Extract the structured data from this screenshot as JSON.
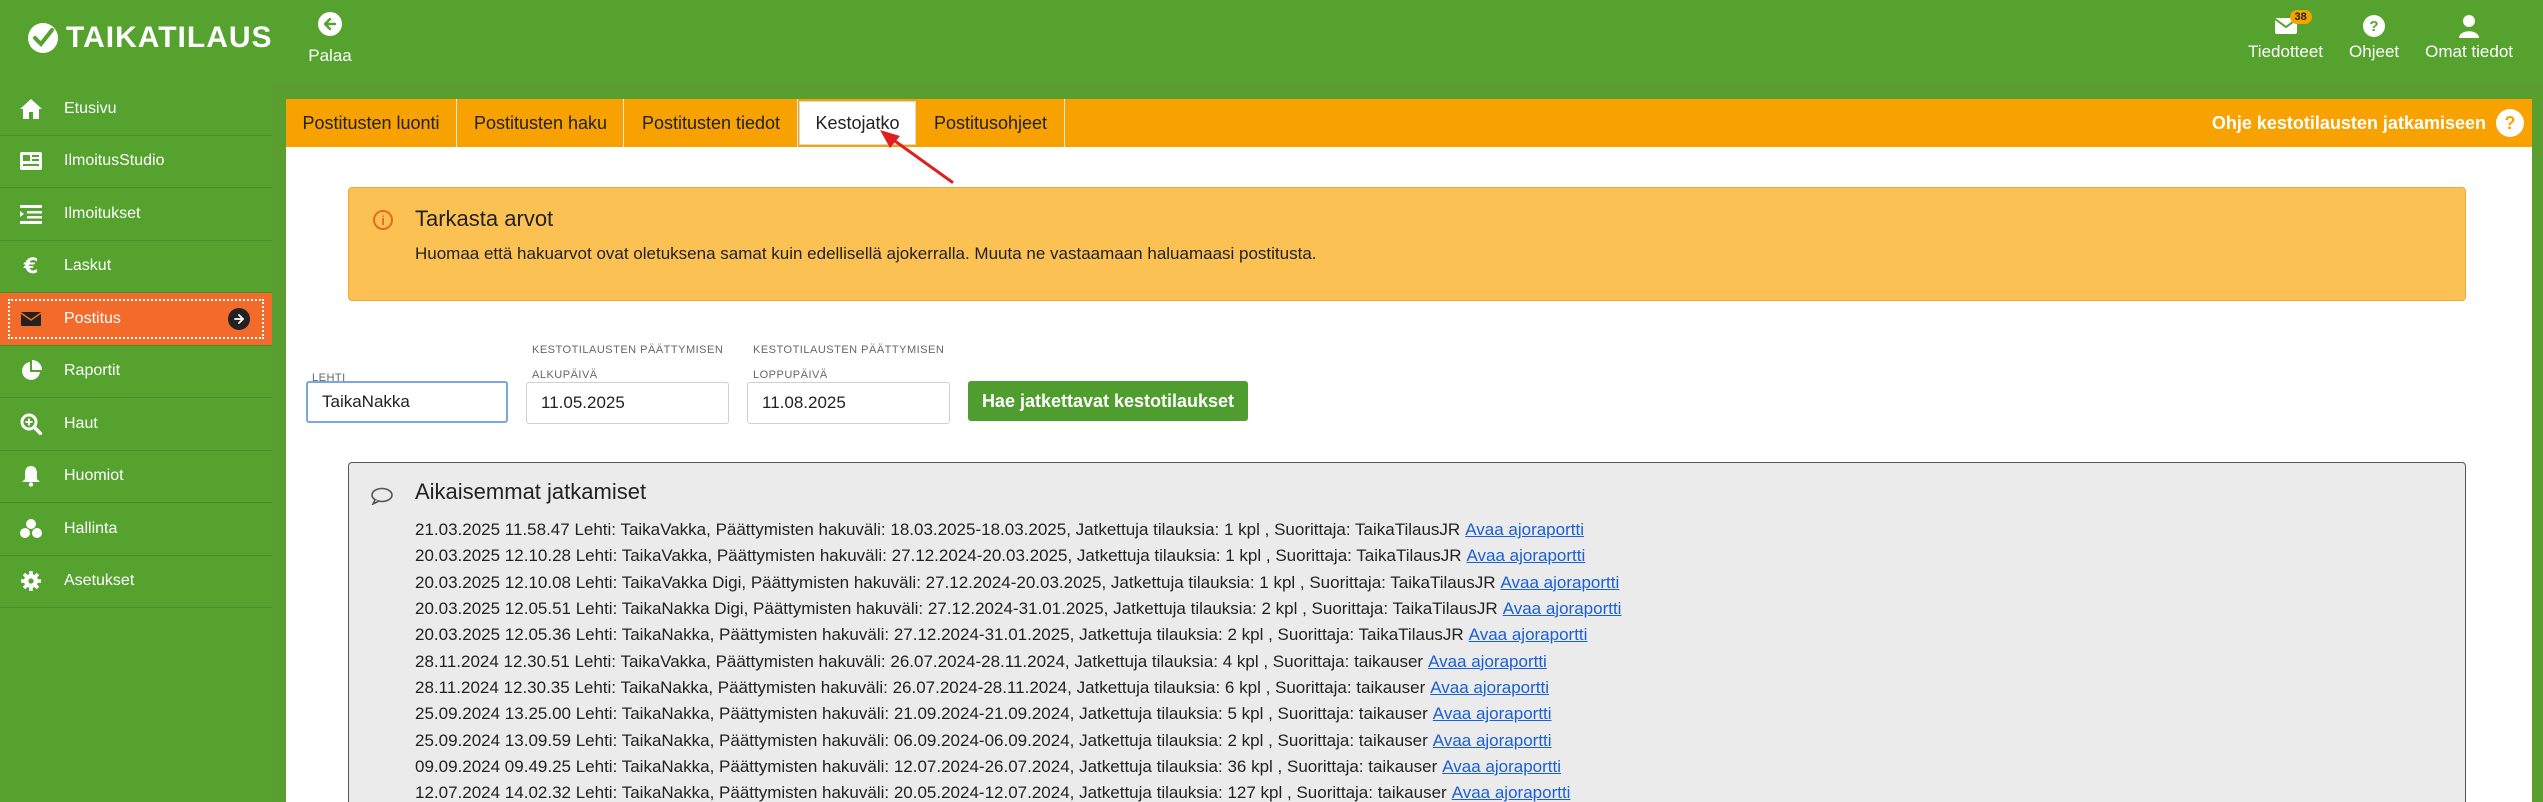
{
  "header": {
    "logo_text": "TAIKATILAUS",
    "back_label": "Palaa",
    "right_items": [
      {
        "label": "Tiedotteet",
        "icon": "mail-icon",
        "badge": "38"
      },
      {
        "label": "Ohjeet",
        "icon": "help-icon"
      },
      {
        "label": "Omat tiedot",
        "icon": "user-icon"
      }
    ]
  },
  "sidebar": {
    "items": [
      {
        "label": "Etusivu",
        "icon": "home-icon"
      },
      {
        "label": "IlmoitusStudio",
        "icon": "newspaper-icon"
      },
      {
        "label": "Ilmoitukset",
        "icon": "list-icon"
      },
      {
        "label": "Laskut",
        "icon": "euro-icon"
      },
      {
        "label": "Postitus",
        "icon": "envelope-icon",
        "active": true
      },
      {
        "label": "Raportit",
        "icon": "pie-chart-icon"
      },
      {
        "label": "Haut",
        "icon": "search-plus-icon"
      },
      {
        "label": "Huomiot",
        "icon": "bell-icon"
      },
      {
        "label": "Hallinta",
        "icon": "cubes-icon"
      },
      {
        "label": "Asetukset",
        "icon": "gear-icon"
      }
    ]
  },
  "tabs": {
    "items": [
      {
        "label": "Postitusten luonti"
      },
      {
        "label": "Postitusten haku"
      },
      {
        "label": "Postitusten tiedot"
      },
      {
        "label": "Kestojatko",
        "active": true
      },
      {
        "label": "Postitusohjeet"
      }
    ],
    "help_label": "Ohje kestotilausten jatkamiseen",
    "help_icon": "?"
  },
  "alert": {
    "icon": "i",
    "title": "Tarkasta arvot",
    "body": "Huomaa että hakuarvot ovat oletuksena samat kuin edellisellä ajokerralla. Muuta ne vastaamaan haluamaasi postitusta."
  },
  "form": {
    "lehti_label": "LEHTI",
    "lehti_value": "TaikaNakka",
    "start_group_label": "KESTOTILAUSTEN PÄÄTTYMISEN",
    "start_label": "ALKUPÄIVÄ",
    "start_value": "11.05.2025",
    "end_group_label": "KESTOTILAUSTEN PÄÄTTYMISEN",
    "end_label": "LOPPUPÄIVÄ",
    "end_value": "11.08.2025",
    "search_button": "Hae jatkettavat kestotilaukset"
  },
  "history": {
    "title": "Aikaisemmat jatkamiset",
    "link_label": "Avaa ajoraportti",
    "rows": [
      {
        "text": "21.03.2025 11.58.47 Lehti: TaikaVakka, Päättymisten hakuväli: 18.03.2025-18.03.2025, Jatkettuja tilauksia: 1 kpl , Suorittaja: TaikaTilausJR"
      },
      {
        "text": "20.03.2025 12.10.28 Lehti: TaikaVakka, Päättymisten hakuväli: 27.12.2024-20.03.2025, Jatkettuja tilauksia: 1 kpl , Suorittaja: TaikaTilausJR"
      },
      {
        "text": "20.03.2025 12.10.08 Lehti: TaikaVakka Digi, Päättymisten hakuväli: 27.12.2024-20.03.2025, Jatkettuja tilauksia: 1 kpl , Suorittaja: TaikaTilausJR"
      },
      {
        "text": "20.03.2025 12.05.51 Lehti: TaikaNakka Digi, Päättymisten hakuväli: 27.12.2024-31.01.2025, Jatkettuja tilauksia: 2 kpl , Suorittaja: TaikaTilausJR"
      },
      {
        "text": "20.03.2025 12.05.36 Lehti: TaikaNakka, Päättymisten hakuväli: 27.12.2024-31.01.2025, Jatkettuja tilauksia: 2 kpl , Suorittaja: TaikaTilausJR"
      },
      {
        "text": "28.11.2024 12.30.51 Lehti: TaikaVakka, Päättymisten hakuväli: 26.07.2024-28.11.2024, Jatkettuja tilauksia: 4 kpl , Suorittaja: taikauser"
      },
      {
        "text": "28.11.2024 12.30.35 Lehti: TaikaNakka, Päättymisten hakuväli: 26.07.2024-28.11.2024, Jatkettuja tilauksia: 6 kpl , Suorittaja: taikauser"
      },
      {
        "text": "25.09.2024 13.25.00 Lehti: TaikaNakka, Päättymisten hakuväli: 21.09.2024-21.09.2024, Jatkettuja tilauksia: 5 kpl , Suorittaja: taikauser"
      },
      {
        "text": "25.09.2024 13.09.59 Lehti: TaikaNakka, Päättymisten hakuväli: 06.09.2024-06.09.2024, Jatkettuja tilauksia: 2 kpl , Suorittaja: taikauser"
      },
      {
        "text": "09.09.2024 09.49.25 Lehti: TaikaNakka, Päättymisten hakuväli: 12.07.2024-26.07.2024, Jatkettuja tilauksia: 36 kpl , Suorittaja: taikauser"
      },
      {
        "text": "12.07.2024 14.02.32 Lehti: TaikaNakka, Päättymisten hakuväli: 20.05.2024-12.07.2024, Jatkettuja tilauksia: 127 kpl , Suorittaja: taikauser"
      }
    ]
  },
  "colors": {
    "green": "#55a22e",
    "orange_tabbar": "#f7a200",
    "active_sidebar": "#f26b2a",
    "alert_bg": "#fcc153",
    "button_green": "#4f9d2f",
    "link_blue": "#1a5fd6",
    "annotation_red": "#e02020"
  }
}
